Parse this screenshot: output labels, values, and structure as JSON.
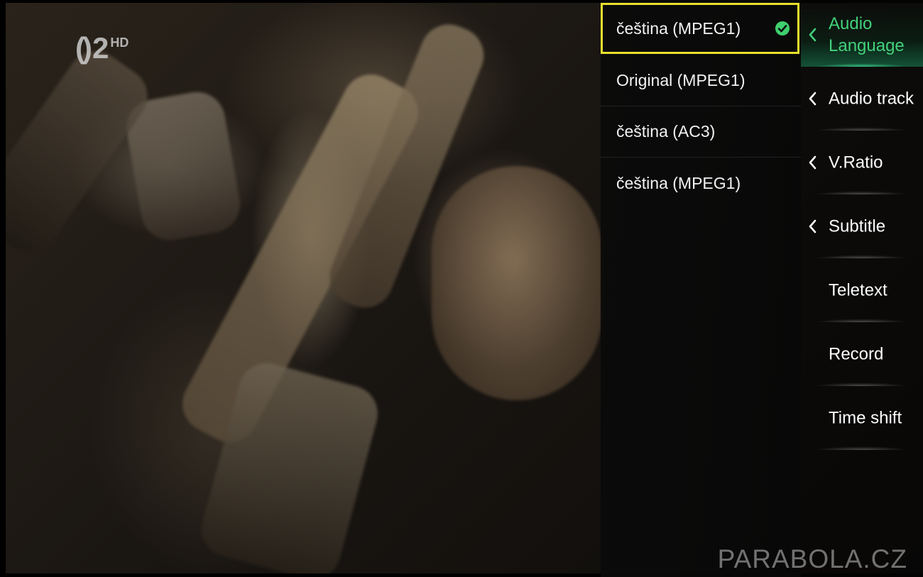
{
  "channel": {
    "logo_num": "2",
    "logo_hd": "HD"
  },
  "audio_language_list": {
    "items": [
      {
        "label": "čeština (MPEG1)",
        "selected": true
      },
      {
        "label": "Original (MPEG1)",
        "selected": false
      },
      {
        "label": "čeština (AC3)",
        "selected": false
      },
      {
        "label": "čeština (MPEG1)",
        "selected": false
      }
    ]
  },
  "side_menu": {
    "items": [
      {
        "label": "Audio Language",
        "has_submenu": true,
        "active": true
      },
      {
        "label": "Audio track",
        "has_submenu": true,
        "active": false
      },
      {
        "label": "V.Ratio",
        "has_submenu": true,
        "active": false
      },
      {
        "label": "Subtitle",
        "has_submenu": true,
        "active": false
      },
      {
        "label": "Teletext",
        "has_submenu": false,
        "active": false
      },
      {
        "label": "Record",
        "has_submenu": false,
        "active": false
      },
      {
        "label": "Time shift",
        "has_submenu": false,
        "active": false
      }
    ]
  },
  "watermark": "PARABOLA.CZ",
  "colors": {
    "focus_border": "#e8df2e",
    "active_green": "#43d07a",
    "check_green": "#3fcf6e"
  },
  "icons": {
    "check": "check-circle-icon",
    "chevron": "chevron-left-icon"
  }
}
